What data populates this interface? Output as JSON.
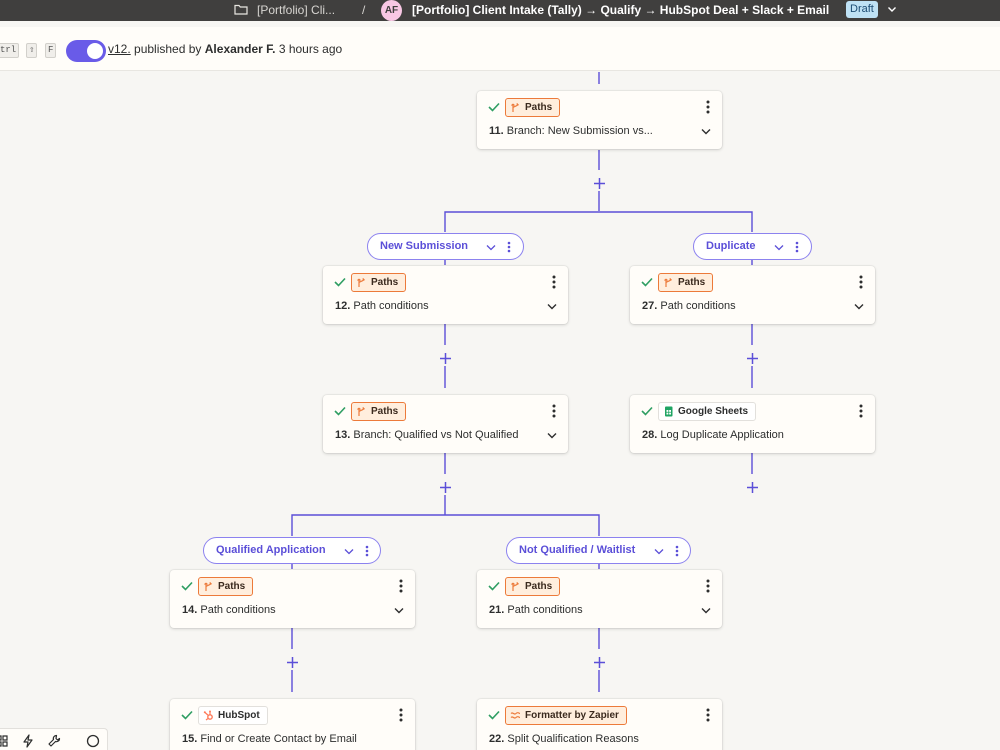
{
  "topbar": {
    "crumb": "[Portfolio] Cli...",
    "sep": "/",
    "avatar": "AF",
    "title": "[Portfolio] Client Intake (Tally) → Qualify → HubSpot Deal + Slack + Email",
    "status": "Draft"
  },
  "subbar": {
    "kbd": [
      "trl",
      "⇧",
      "F"
    ],
    "published": true,
    "version": "v12.",
    "published_by": "published by",
    "author": "Alexander F.",
    "time": "3 hours ago"
  },
  "colors": {
    "accent": "#695be8",
    "paths": "#ec7a3a",
    "check": "#2f9e63",
    "wire": "#5b4fd8"
  },
  "steps": {
    "s11": {
      "app": "Paths",
      "num": "11.",
      "label": "Branch: New Submission vs..."
    },
    "s12": {
      "app": "Paths",
      "num": "12.",
      "label": "Path conditions"
    },
    "s27": {
      "app": "Paths",
      "num": "27.",
      "label": "Path conditions"
    },
    "s13": {
      "app": "Paths",
      "num": "13.",
      "label": "Branch: Qualified vs Not Qualified"
    },
    "s28": {
      "app": "Google Sheets",
      "num": "28.",
      "label": "Log Duplicate Application"
    },
    "s14": {
      "app": "Paths",
      "num": "14.",
      "label": "Path conditions"
    },
    "s21": {
      "app": "Paths",
      "num": "21.",
      "label": "Path conditions"
    },
    "s15": {
      "app": "HubSpot",
      "num": "15.",
      "label": "Find or Create Contact by Email"
    },
    "s22": {
      "app": "Formatter by Zapier",
      "num": "22.",
      "label": "Split Qualification Reasons"
    }
  },
  "paths": {
    "new_submission": "New Submission",
    "duplicate": "Duplicate",
    "qualified": "Qualified Application",
    "not_qualified": "Not Qualified / Waitlist"
  },
  "icons": {
    "folder": "folder-icon",
    "chevron": "chevron-down-icon",
    "check": "check-icon",
    "paths": "paths-icon",
    "sheets": "google-sheets-icon",
    "hubspot": "hubspot-icon",
    "formatter": "formatter-icon",
    "kebab": "kebab-icon",
    "plus": "plus-icon"
  }
}
